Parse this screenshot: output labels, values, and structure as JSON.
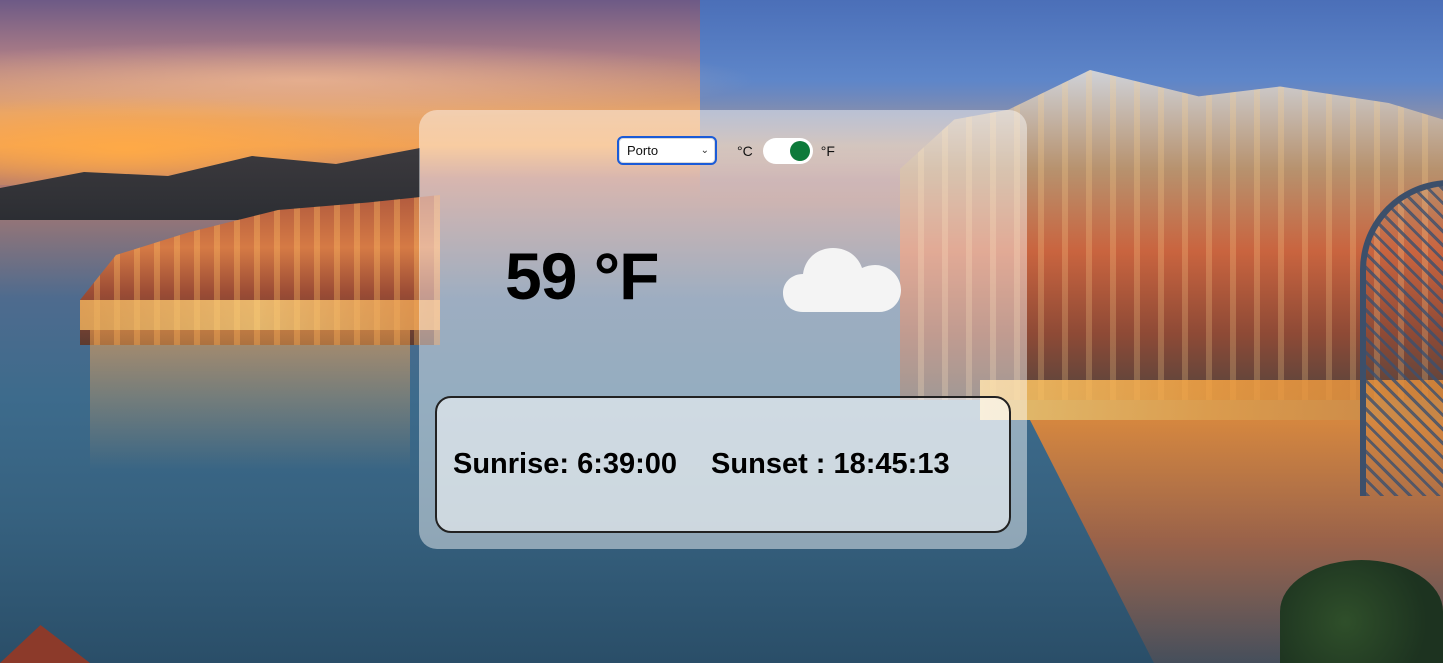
{
  "background": {
    "description_icon": "porto-riverside-photo"
  },
  "controls": {
    "city_selected": "Porto",
    "celsius_label": "°C",
    "fahrenheit_label": "°F",
    "unit_toggle_state": "F",
    "accent_color": "#0d7a3a"
  },
  "weather": {
    "temperature": "59 °F",
    "condition_icon": "cloud-icon"
  },
  "sun": {
    "sunrise": "Sunrise: 6:39:00",
    "sunset": "Sunset : 18:45:13"
  }
}
